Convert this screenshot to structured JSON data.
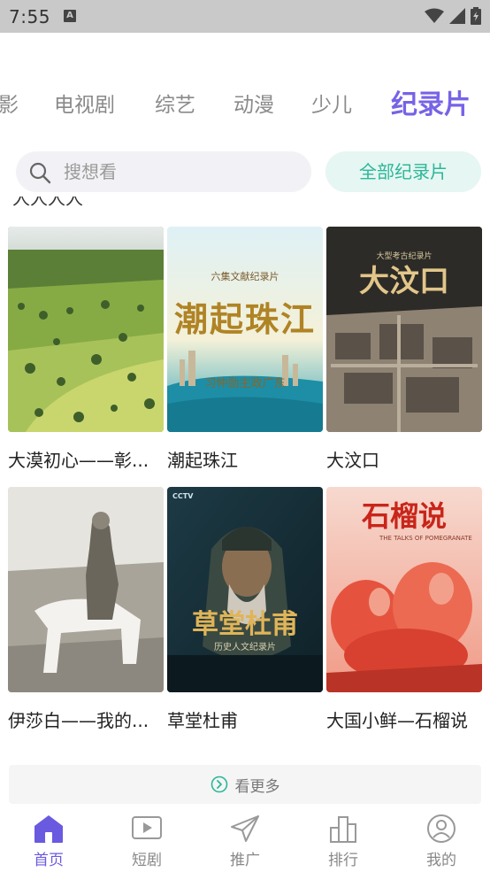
{
  "status_bar": {
    "time": "7:55",
    "indicator": "A"
  },
  "tabs": [
    {
      "label": "影"
    },
    {
      "label": "电视剧"
    },
    {
      "label": "综艺"
    },
    {
      "label": "动漫"
    },
    {
      "label": "少儿"
    },
    {
      "label": "纪录片"
    }
  ],
  "search": {
    "placeholder": "搜想看",
    "all_button": "全部纪录片"
  },
  "partial_row_text": "人人人人",
  "items": [
    {
      "title": "大漠初心——彰...",
      "poster_text": ""
    },
    {
      "title": "潮起珠江",
      "poster_text": "潮起珠江",
      "poster_caption": "六集文献纪录片",
      "poster_sub": "习仲勋主政广东"
    },
    {
      "title": "大汶口",
      "poster_text": "大汶口",
      "poster_caption": "大型考古纪录片"
    },
    {
      "title": "伊莎白——我的...",
      "poster_text": ""
    },
    {
      "title": "草堂杜甫",
      "poster_text": "草堂杜甫",
      "poster_caption": "历史人文纪录片",
      "poster_logo": "CCTV"
    },
    {
      "title": "大国小鲜—石榴说",
      "poster_text": "石榴说",
      "poster_caption": "THE TALKS OF POMEGRANATE"
    }
  ],
  "more_label": "看更多",
  "bottom_nav": [
    {
      "label": "首页",
      "icon": "home-icon",
      "active": true
    },
    {
      "label": "短剧",
      "icon": "play-icon",
      "active": false
    },
    {
      "label": "推广",
      "icon": "send-icon",
      "active": false
    },
    {
      "label": "排行",
      "icon": "rank-icon",
      "active": false
    },
    {
      "label": "我的",
      "icon": "profile-icon",
      "active": false
    }
  ],
  "colors": {
    "accent": "#7663e6",
    "green": "#2cb79a",
    "status_bar": "#c9c9c9"
  }
}
